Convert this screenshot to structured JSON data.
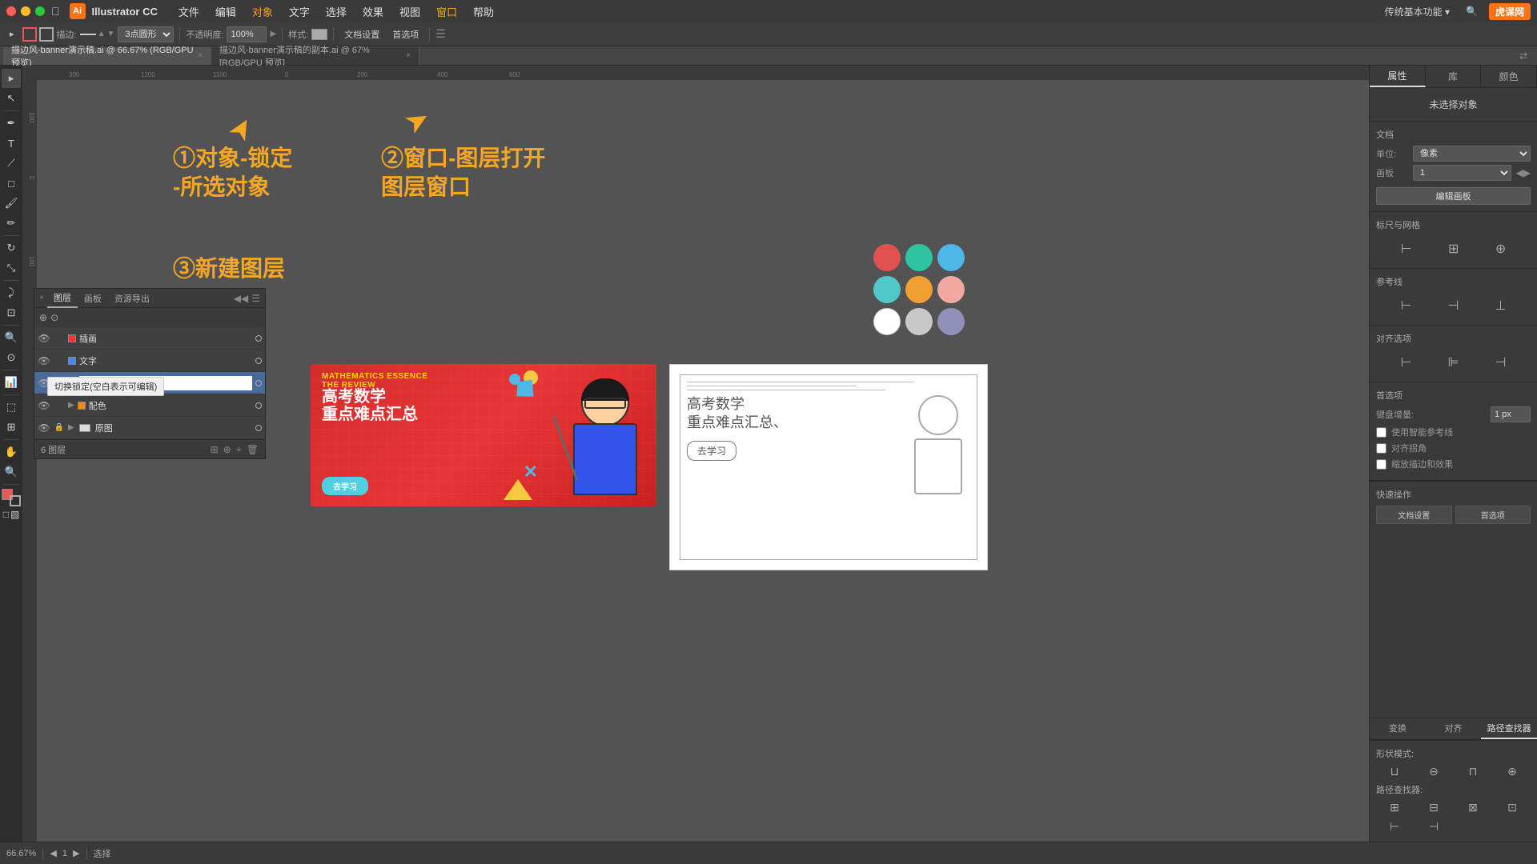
{
  "app": {
    "name": "Illustrator CC",
    "icon": "Ai",
    "version": "CC"
  },
  "menu": {
    "apple": "⌘",
    "items": [
      "文件",
      "编辑",
      "对象",
      "文字",
      "选择",
      "效果",
      "视图",
      "窗口",
      "帮助"
    ]
  },
  "toolbar": {
    "no_selection": "未选择对象",
    "stroke_label": "描边:",
    "stroke_points": "3点圆形",
    "opacity_label": "不透明度:",
    "opacity_value": "100%",
    "style_label": "样式:",
    "doc_settings": "文档设置",
    "prefs": "首选项"
  },
  "tabs": [
    {
      "label": "描边风-banner演示稿.ai",
      "suffix": "@ 66.67% (RGB/GPU 预览)",
      "active": true
    },
    {
      "label": "描边风-banner演示稿的副本.ai",
      "suffix": "@ 67% [RGB/GPU 预览]",
      "active": false
    }
  ],
  "annotations": {
    "step1": "①对象-锁定",
    "step1b": "-所选对象",
    "step2": "②窗口-图层打开",
    "step2b": "图层窗口",
    "step3": "③新建图层"
  },
  "banner": {
    "title_en1": "MATHEMATICS ESSENCE",
    "title_en2": "THE REVIEW",
    "title_cn1": "高考数学",
    "title_cn2": "重点难点汇总",
    "button_text": "去学习",
    "bg_color": "#e03030"
  },
  "layers_panel": {
    "title": "图层",
    "tabs": [
      "图层",
      "画板",
      "资源导出"
    ],
    "layers": [
      {
        "name": "插画",
        "color": "#ff0000",
        "visible": true,
        "locked": false
      },
      {
        "name": "文字",
        "color": "#4488ff",
        "visible": true,
        "locked": false
      },
      {
        "name": "",
        "color": "#aaddff",
        "visible": true,
        "locked": false,
        "active": true
      },
      {
        "name": "配色",
        "color": "#ff8800",
        "visible": true,
        "locked": false,
        "expanded": true
      },
      {
        "name": "原图",
        "color": "#888888",
        "visible": true,
        "locked": true
      }
    ],
    "layer_count": "6 图层",
    "tooltip": "切换锁定(空白表示可编辑)"
  },
  "right_panel": {
    "tabs": [
      "属性",
      "库",
      "颜色"
    ],
    "no_selection": "未选择对象",
    "document_section": "文档",
    "units_label": "单位:",
    "units_value": "像素",
    "artboard_label": "画板",
    "artboard_value": "1",
    "edit_artboard": "编辑画板",
    "alignment_title": "标尺与网格",
    "guides_title": "参考线",
    "align_title": "对齐选项",
    "prefs_title": "首选项",
    "keyboard_increment": "键盘增量:",
    "increment_value": "1 px",
    "smart_guides": "使用智能参考线",
    "snap_corners": "对齐拐角",
    "snap_effects": "缩放描边和效果",
    "quick_actions": "快速操作",
    "doc_settings_btn": "文档设置",
    "prefs_btn": "首选项",
    "path_finder": "路径查找器",
    "shape_modes": "形状模式:",
    "path_finder_label": "路径查找器:"
  },
  "colors": {
    "red": "#e05050",
    "teal": "#2ec4a0",
    "blue": "#4db8e8",
    "light_blue": "#50c8c8",
    "orange": "#f0a030",
    "peach": "#f0a8a0",
    "white": "#ffffff",
    "light_gray": "#c8c8c8",
    "purple_gray": "#9090b8"
  },
  "status_bar": {
    "zoom": "66.67%",
    "artboard": "1",
    "tool": "选择"
  },
  "icons": {
    "eye": "👁",
    "lock": "🔒",
    "arrow_right": "▶",
    "plus": "+",
    "trash": "🗑",
    "grid": "⊞",
    "align_left": "⊢",
    "chevron_down": "▾",
    "chevron_right": "▸",
    "close": "×",
    "move_panel": "⋮⋮"
  }
}
